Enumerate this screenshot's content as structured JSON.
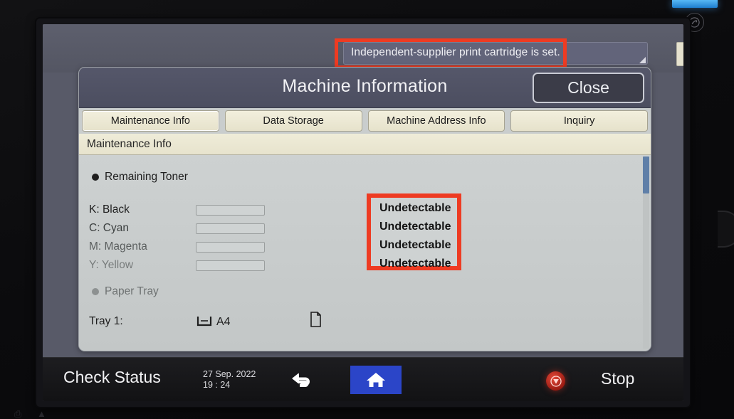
{
  "device": {
    "power_icon": "power-energy-saver-icon",
    "led_indicator": "blue-status-led"
  },
  "status_bar": {
    "message": "Independent-supplier print cartridge is set.",
    "help_label": "?",
    "sleep_icon": "crescent-moon-icon",
    "resize_handle": "resize-handle-icon"
  },
  "dialog": {
    "title": "Machine Information",
    "close_label": "Close",
    "tabs": [
      {
        "label": "Maintenance Info",
        "active": true
      },
      {
        "label": "Data Storage",
        "active": false
      },
      {
        "label": "Machine Address Info",
        "active": false
      },
      {
        "label": "Inquiry",
        "active": false
      }
    ],
    "section_header": "Maintenance Info",
    "toner": {
      "heading": "Remaining Toner",
      "rows": [
        {
          "label": "K: Black",
          "level": 0,
          "status": "Undetectable"
        },
        {
          "label": "C: Cyan",
          "level": 0,
          "status": "Undetectable"
        },
        {
          "label": "M: Magenta",
          "level": 0,
          "status": "Undetectable"
        },
        {
          "label": "Y: Yellow",
          "level": 0,
          "status": "Undetectable"
        }
      ]
    },
    "paper_tray": {
      "heading": "Paper Tray",
      "rows": [
        {
          "label": "Tray 1:",
          "size": "A4",
          "tray_icon": "paper-tray-icon",
          "sheet_icon": "paper-sheet-icon"
        }
      ]
    },
    "scrollbar": {
      "position": "top"
    }
  },
  "bottom_bar": {
    "check_status_label": "Check Status",
    "date": "27 Sep. 2022",
    "time": "19 : 24",
    "back_icon": "back-arrow-icon",
    "home_icon": "home-icon",
    "stop_icon": "stop-icon",
    "stop_label": "Stop"
  },
  "colors": {
    "accent_blue": "#2b45c8",
    "annotation_red": "#ee3b22",
    "tab_cream": "#efecd8",
    "panel_gray": "#c5c9c9",
    "titlebar_slate": "#55576a"
  }
}
